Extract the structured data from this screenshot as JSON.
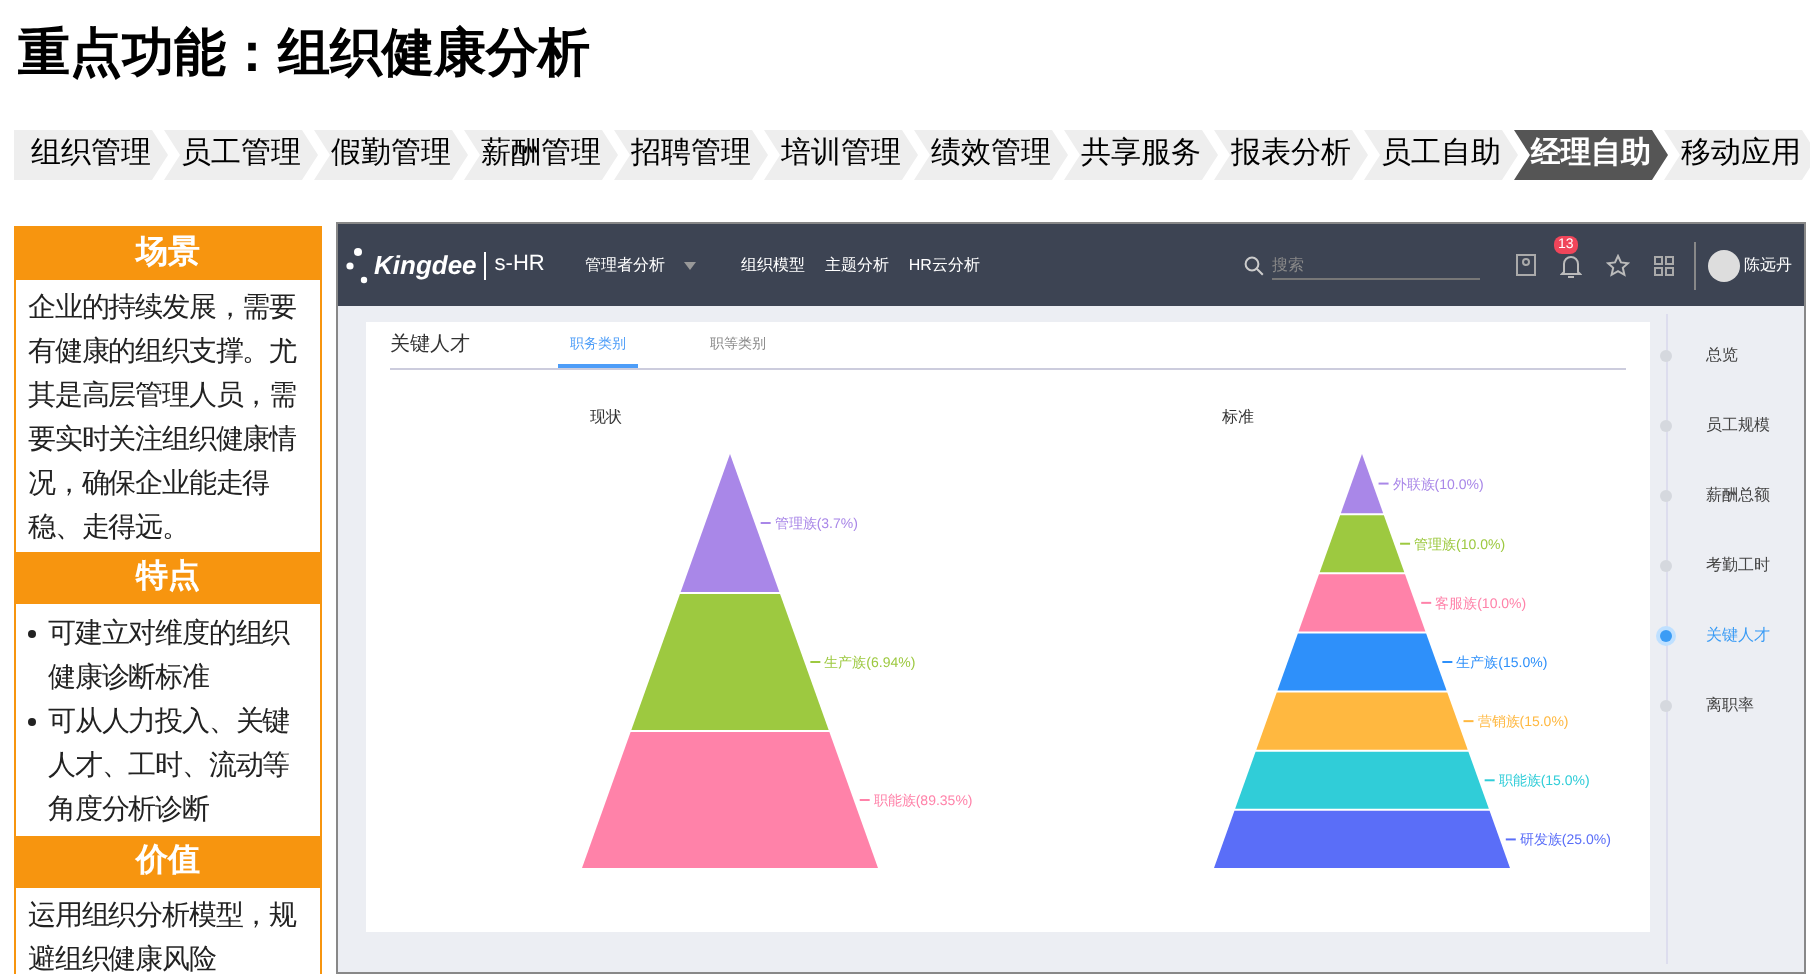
{
  "title": "重点功能：组织健康分析",
  "nav": [
    {
      "label": "组织管理",
      "selected": false
    },
    {
      "label": "员工管理",
      "selected": false
    },
    {
      "label": "假勤管理",
      "selected": false
    },
    {
      "label": "薪酬管理",
      "selected": false
    },
    {
      "label": "招聘管理",
      "selected": false
    },
    {
      "label": "培训管理",
      "selected": false
    },
    {
      "label": "绩效管理",
      "selected": false
    },
    {
      "label": "共享服务",
      "selected": false
    },
    {
      "label": "报表分析",
      "selected": false
    },
    {
      "label": "员工自助",
      "selected": false
    },
    {
      "label": "经理自助",
      "selected": true
    },
    {
      "label": "移动应用",
      "selected": false
    }
  ],
  "side_panel": [
    {
      "heading": "场景",
      "kind": "text",
      "text": "企业的持续发展，需要有健康的组织支撑。尤其是高层管理人员，需要实时关注组织健康情况，确保企业能走得稳、走得远。"
    },
    {
      "heading": "特点",
      "kind": "bullets",
      "items": [
        "可建立对维度的组织健康诊断标准",
        "可从人力投入、关键人才、工时、流动等角度分析诊断"
      ]
    },
    {
      "heading": "价值",
      "kind": "text",
      "text": "运用组织分析模型，规避组织健康风险"
    }
  ],
  "app": {
    "logo": "Kingdee",
    "product": "s-HR",
    "menu": "管理者分析",
    "links": [
      "组织模型",
      "主题分析",
      "HR云分析"
    ],
    "search_placeholder": "搜索",
    "notification_count": "13",
    "user": "陈远丹",
    "card": {
      "title": "关键人才",
      "tabs": [
        {
          "label": "职务类别",
          "selected": true
        },
        {
          "label": "职等类别",
          "selected": false
        }
      ],
      "pyramids": [
        {
          "title": "现状",
          "segments": [
            {
              "label": "管理族(3.7%)",
              "color": "#a987e8"
            },
            {
              "label": "生产族(6.94%)",
              "color": "#9dc940"
            },
            {
              "label": "职能族(89.35%)",
              "color": "#ff82a9"
            }
          ]
        },
        {
          "title": "标准",
          "segments": [
            {
              "label": "外联族(10.0%)",
              "color": "#a987e8"
            },
            {
              "label": "管理族(10.0%)",
              "color": "#9dc940"
            },
            {
              "label": "客服族(10.0%)",
              "color": "#ff82a9"
            },
            {
              "label": "生产族(15.0%)",
              "color": "#2e90fa"
            },
            {
              "label": "营销族(15.0%)",
              "color": "#ffb840"
            },
            {
              "label": "职能族(15.0%)",
              "color": "#30cdd8"
            },
            {
              "label": "研发族(25.0%)",
              "color": "#5a6ef8"
            }
          ]
        }
      ]
    },
    "side_nav": [
      {
        "label": "总览",
        "selected": false
      },
      {
        "label": "员工规模",
        "selected": false
      },
      {
        "label": "薪酬总额",
        "selected": false
      },
      {
        "label": "考勤工时",
        "selected": false
      },
      {
        "label": "关键人才",
        "selected": true
      },
      {
        "label": "离职率",
        "selected": false
      }
    ]
  }
}
